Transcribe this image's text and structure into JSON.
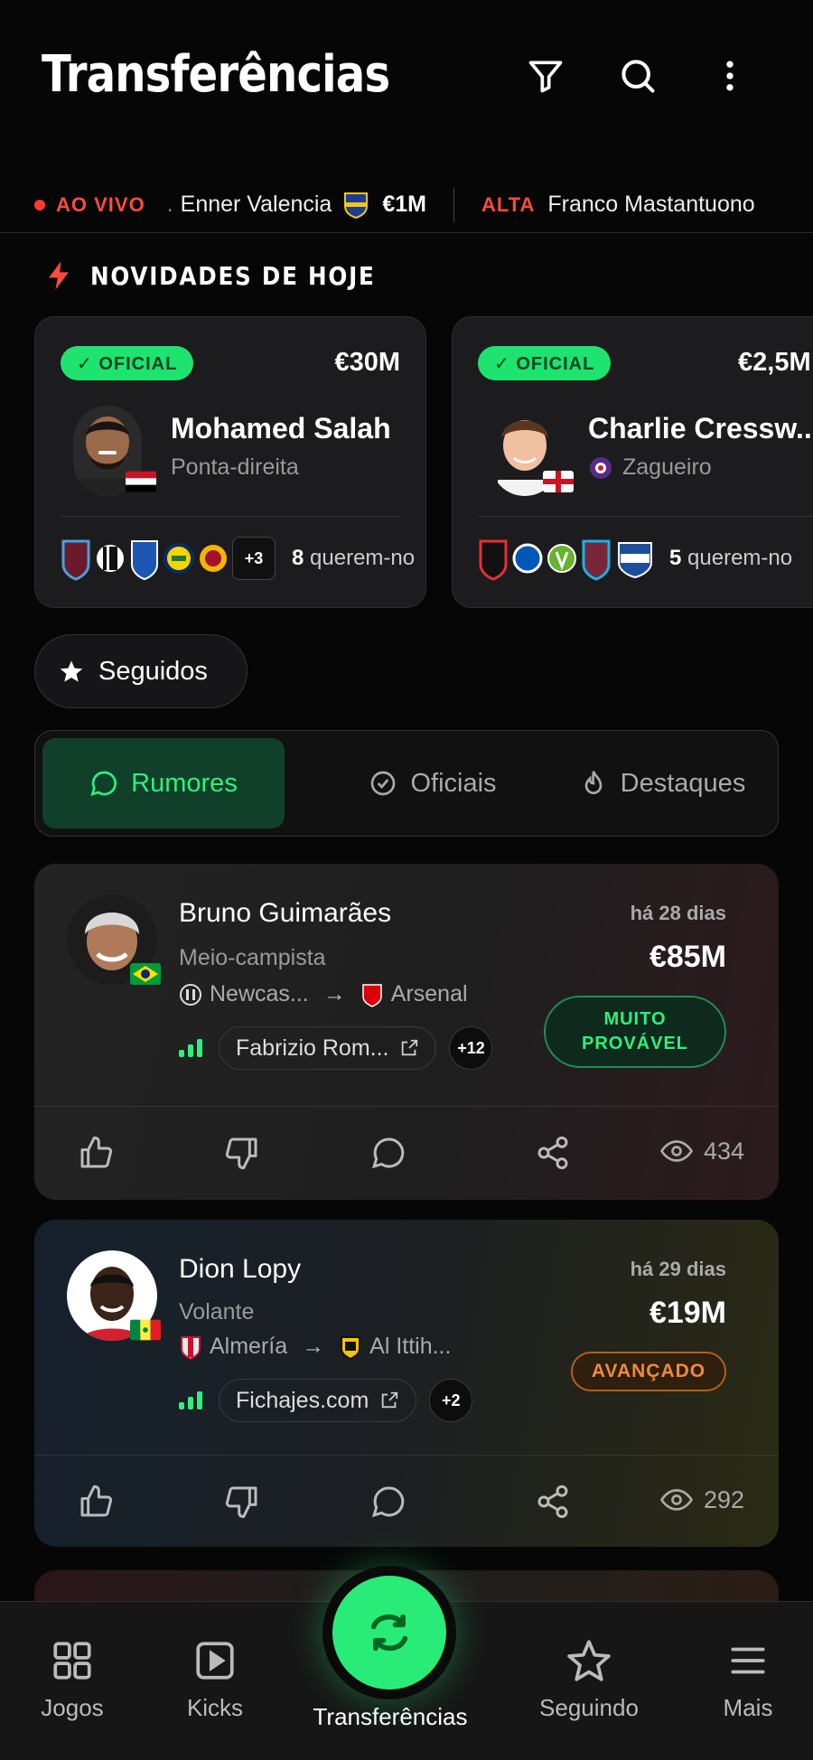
{
  "header": {
    "title": "Transferências",
    "icons": [
      "filter-icon",
      "search-icon",
      "more-vertical-icon"
    ]
  },
  "ticker": {
    "live_label": "AO VIVO",
    "item1_name": "Enner Valencia",
    "item1_fee": "€1M",
    "item2_label": "ALTA",
    "item2_name": "Franco Mastantuono"
  },
  "section": {
    "title": "NOVIDADES DE HOJE"
  },
  "official_cards": [
    {
      "badge": "✓ OFICIAL",
      "fee": "€30M",
      "name": "Mohamed Salah",
      "position": "Ponta-direita",
      "extra_count": "+3",
      "interest_count": "8",
      "interest_text": " querem-no"
    },
    {
      "badge": "✓ OFICIAL",
      "fee": "€2,5M",
      "name": "Charlie Cressw...",
      "position": "Zagueiro",
      "interest_count": "5",
      "interest_text": " querem-no"
    }
  ],
  "seguidos": {
    "label": "Seguidos"
  },
  "tabs": [
    {
      "label": "Rumores",
      "active": true
    },
    {
      "label": "Oficiais",
      "active": false
    },
    {
      "label": "Destaques",
      "active": false
    }
  ],
  "rumors": [
    {
      "name": "Bruno Guimarães",
      "position": "Meio-campista",
      "from": "Newcas...",
      "to": "Arsenal",
      "source": "Fabrizio Rom...",
      "extra_sources": "+12",
      "time": "há 28 dias",
      "fee": "€85M",
      "status": "MUITO PROVÁVEL",
      "status_color": "#2ff07d",
      "views": "434"
    },
    {
      "name": "Dion Lopy",
      "position": "Volante",
      "from": "Almería",
      "to": "Al Ittih...",
      "source": "Fichajes.com",
      "extra_sources": "+2",
      "time": "há 29 dias",
      "fee": "€19M",
      "status": "AVANÇADO",
      "status_color": "#f08a3a",
      "views": "292"
    }
  ],
  "bottom_nav": [
    {
      "label": "Jogos",
      "icon": "grid-icon"
    },
    {
      "label": "Kicks",
      "icon": "play-icon"
    },
    {
      "label": "Transferências",
      "icon": "swap-icon",
      "active": true
    },
    {
      "label": "Seguindo",
      "icon": "star-icon"
    },
    {
      "label": "Mais",
      "icon": "menu-icon"
    }
  ]
}
